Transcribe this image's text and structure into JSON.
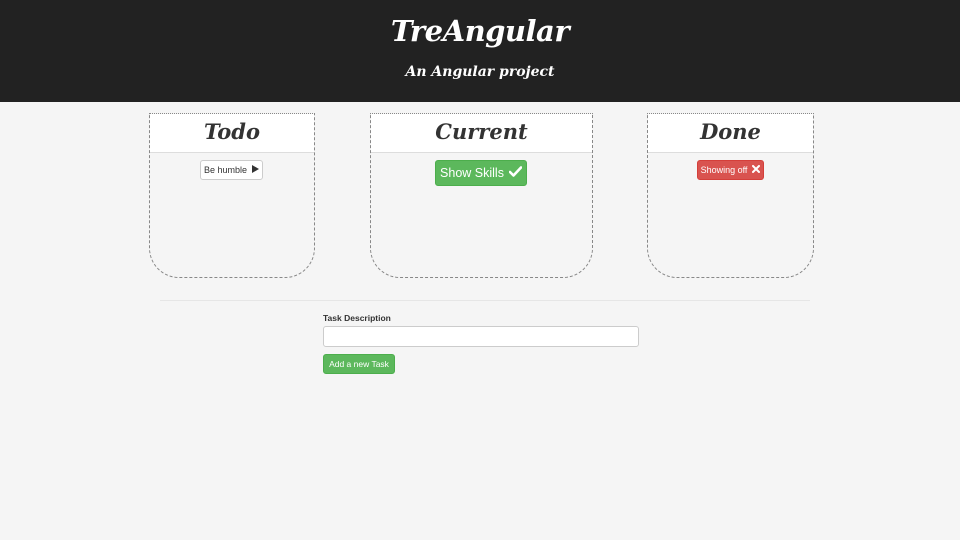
{
  "header": {
    "title": "TreAngular",
    "subtitle": "An Angular project"
  },
  "columns": [
    {
      "title": "Todo",
      "tasks": [
        {
          "label": "Be humble",
          "icon": "play-icon",
          "style": "default"
        }
      ]
    },
    {
      "title": "Current",
      "tasks": [
        {
          "label": "Show Skills",
          "icon": "check-icon",
          "style": "success"
        }
      ]
    },
    {
      "title": "Done",
      "tasks": [
        {
          "label": "Showing off",
          "icon": "times-icon",
          "style": "danger"
        }
      ]
    }
  ],
  "form": {
    "label": "Task Description",
    "value": "",
    "placeholder": "",
    "button_label": "Add a new Task"
  },
  "colors": {
    "header_bg": "#222222",
    "success": "#5cb85c",
    "danger": "#d9534f"
  }
}
